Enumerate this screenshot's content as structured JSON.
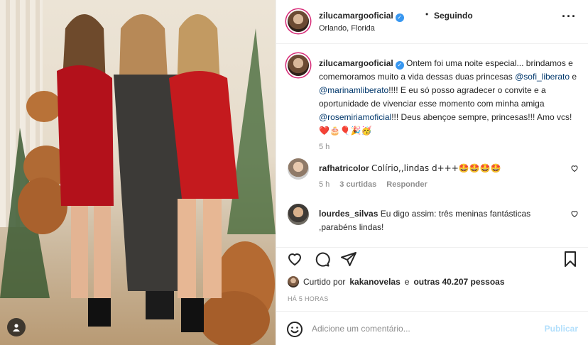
{
  "post": {
    "username": "zilucamargooficial",
    "verified": true,
    "follow_status": "Seguindo",
    "location": "Orlando, Florida",
    "more_icon": "more-horizontal-icon"
  },
  "caption": {
    "username": "zilucamargooficial",
    "text_1": "Ontem foi uma noite especial... brindamos e comemoramos muito a vida dessas duas princesas ",
    "mention_1": "@sofi_liberato",
    "text_2": " e ",
    "mention_2": "@marinamliberato",
    "text_3": "!!!! E eu só posso agradecer o convite e a oportunidade de vivenciar esse momento com minha amiga ",
    "mention_3": "@rosemiriamoficial",
    "text_4": "!!! Deus abençoe sempre, princesas!!! Amo vcs!",
    "emojis": "❤️🎂🎈🎉🥳",
    "time": "5 h"
  },
  "comments": [
    {
      "username": "rafhatricolor",
      "text": "Colírio,,lindas d+++🤩🤩🤩🤩",
      "time": "5 h",
      "likes": "3 curtidas",
      "reply": "Responder"
    },
    {
      "username": "lourdes_silvas",
      "text": "Eu digo assim: três meninas fantásticas ,parabéns lindas!"
    }
  ],
  "actions": {
    "liked_by_prefix": "Curtido por",
    "liked_by_user": "kakanovelas",
    "liked_by_joiner": "e",
    "liked_by_others": "outras 40.207 pessoas",
    "posted_ago": "HÁ 5 HORAS"
  },
  "add_comment": {
    "placeholder": "Adicione um comentário...",
    "post_label": "Publicar"
  },
  "colors": {
    "accent": "#3897f0",
    "post_disabled": "#b2dffc",
    "mention": "#00376b",
    "muted": "#8e8e8e"
  }
}
